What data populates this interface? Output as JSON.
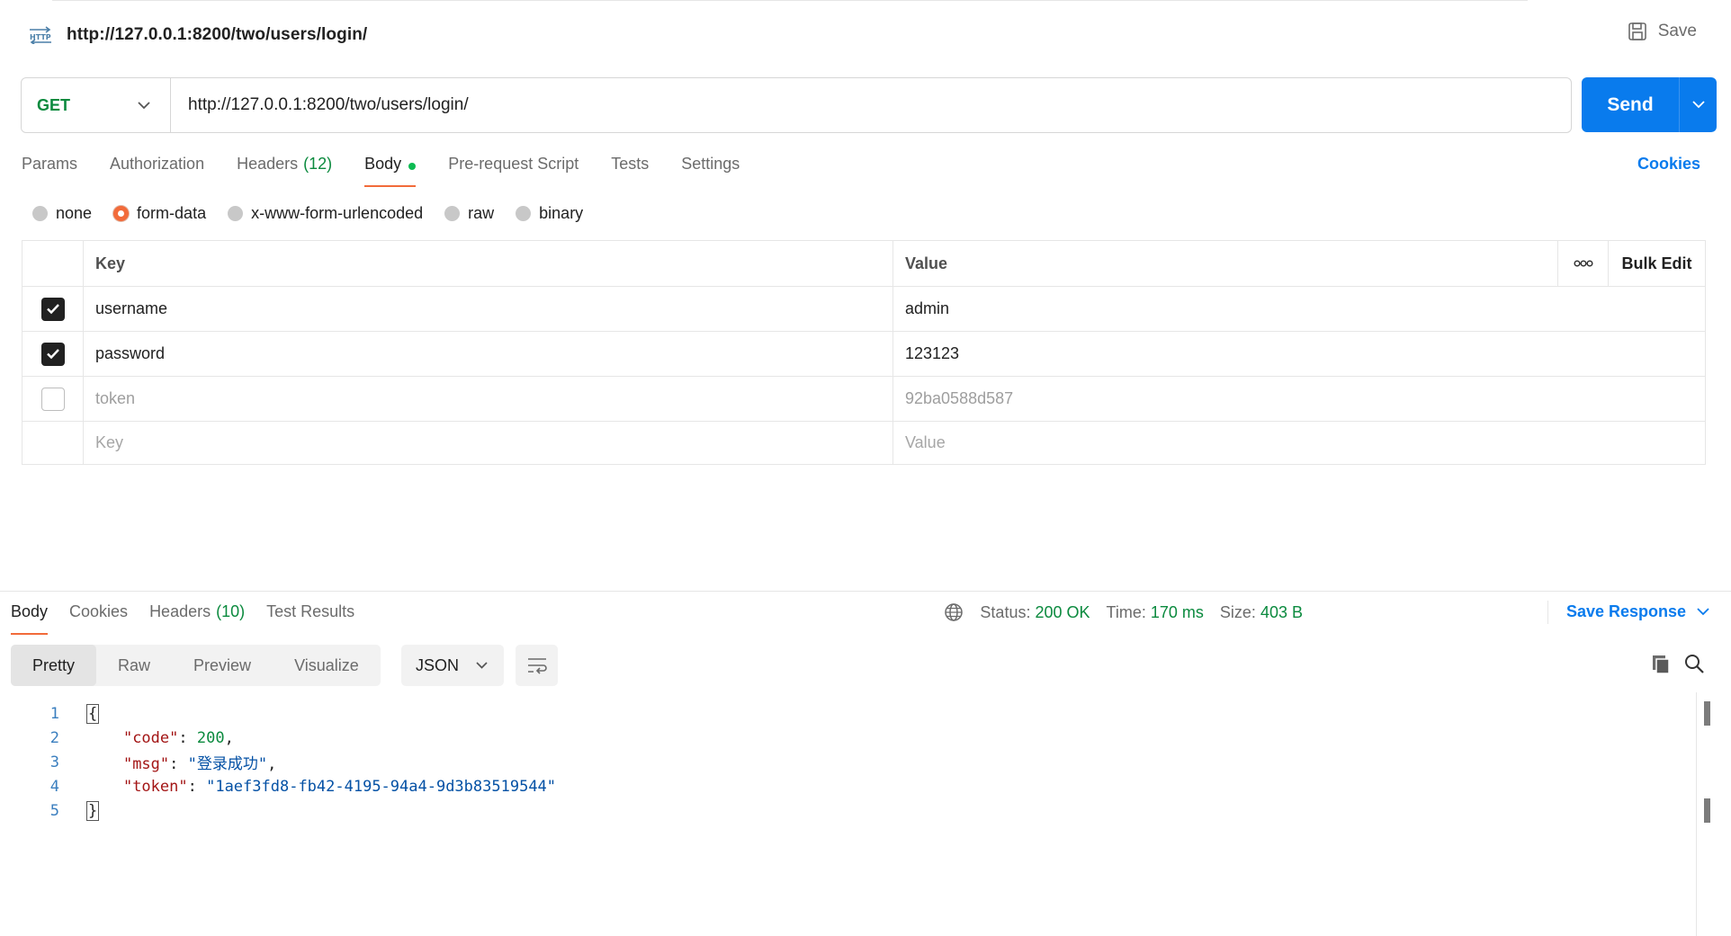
{
  "request": {
    "title": "http://127.0.0.1:8200/two/users/login/",
    "save_label": "Save",
    "method": "GET",
    "url": "http://127.0.0.1:8200/two/users/login/",
    "send_label": "Send"
  },
  "request_tabs": {
    "params": "Params",
    "authorization": "Authorization",
    "headers": "Headers",
    "headers_count": "(12)",
    "body": "Body",
    "pre_request": "Pre-request Script",
    "tests": "Tests",
    "settings": "Settings",
    "cookies": "Cookies"
  },
  "body_types": {
    "none": "none",
    "form_data": "form-data",
    "urlencoded": "x-www-form-urlencoded",
    "raw": "raw",
    "binary": "binary",
    "selected": "form-data"
  },
  "form_table": {
    "key_header": "Key",
    "value_header": "Value",
    "more_icon": "ooo",
    "bulk_edit": "Bulk Edit",
    "rows": [
      {
        "key": "username",
        "value": "admin",
        "checked": true
      },
      {
        "key": "password",
        "value": "123123",
        "checked": true
      },
      {
        "key": "token",
        "value": "92ba0588d587",
        "checked": false
      }
    ],
    "key_placeholder": "Key",
    "value_placeholder": "Value"
  },
  "response_tabs": {
    "body": "Body",
    "cookies": "Cookies",
    "headers": "Headers",
    "headers_count": "(10)",
    "test_results": "Test Results"
  },
  "status": {
    "status_label": "Status:",
    "status_value": "200 OK",
    "time_label": "Time:",
    "time_value": "170 ms",
    "size_label": "Size:",
    "size_value": "403 B",
    "save_response": "Save Response"
  },
  "view": {
    "pretty": "Pretty",
    "raw": "Raw",
    "preview": "Preview",
    "visualize": "Visualize",
    "format": "JSON"
  },
  "response_code": {
    "line_numbers": [
      "1",
      "2",
      "3",
      "4",
      "5"
    ],
    "open_brace": "{",
    "code_key": "\"code\"",
    "code_value": "200",
    "msg_key": "\"msg\"",
    "msg_value": "\"登录成功\"",
    "token_key": "\"token\"",
    "token_value": "\"1aef3fd8-fb42-4195-94a4-9d3b83519544\"",
    "close_brace": "}"
  },
  "colors": {
    "accent_blue": "#097bed",
    "accent_orange": "#f26b3a",
    "success_green": "#0b8a3e"
  }
}
